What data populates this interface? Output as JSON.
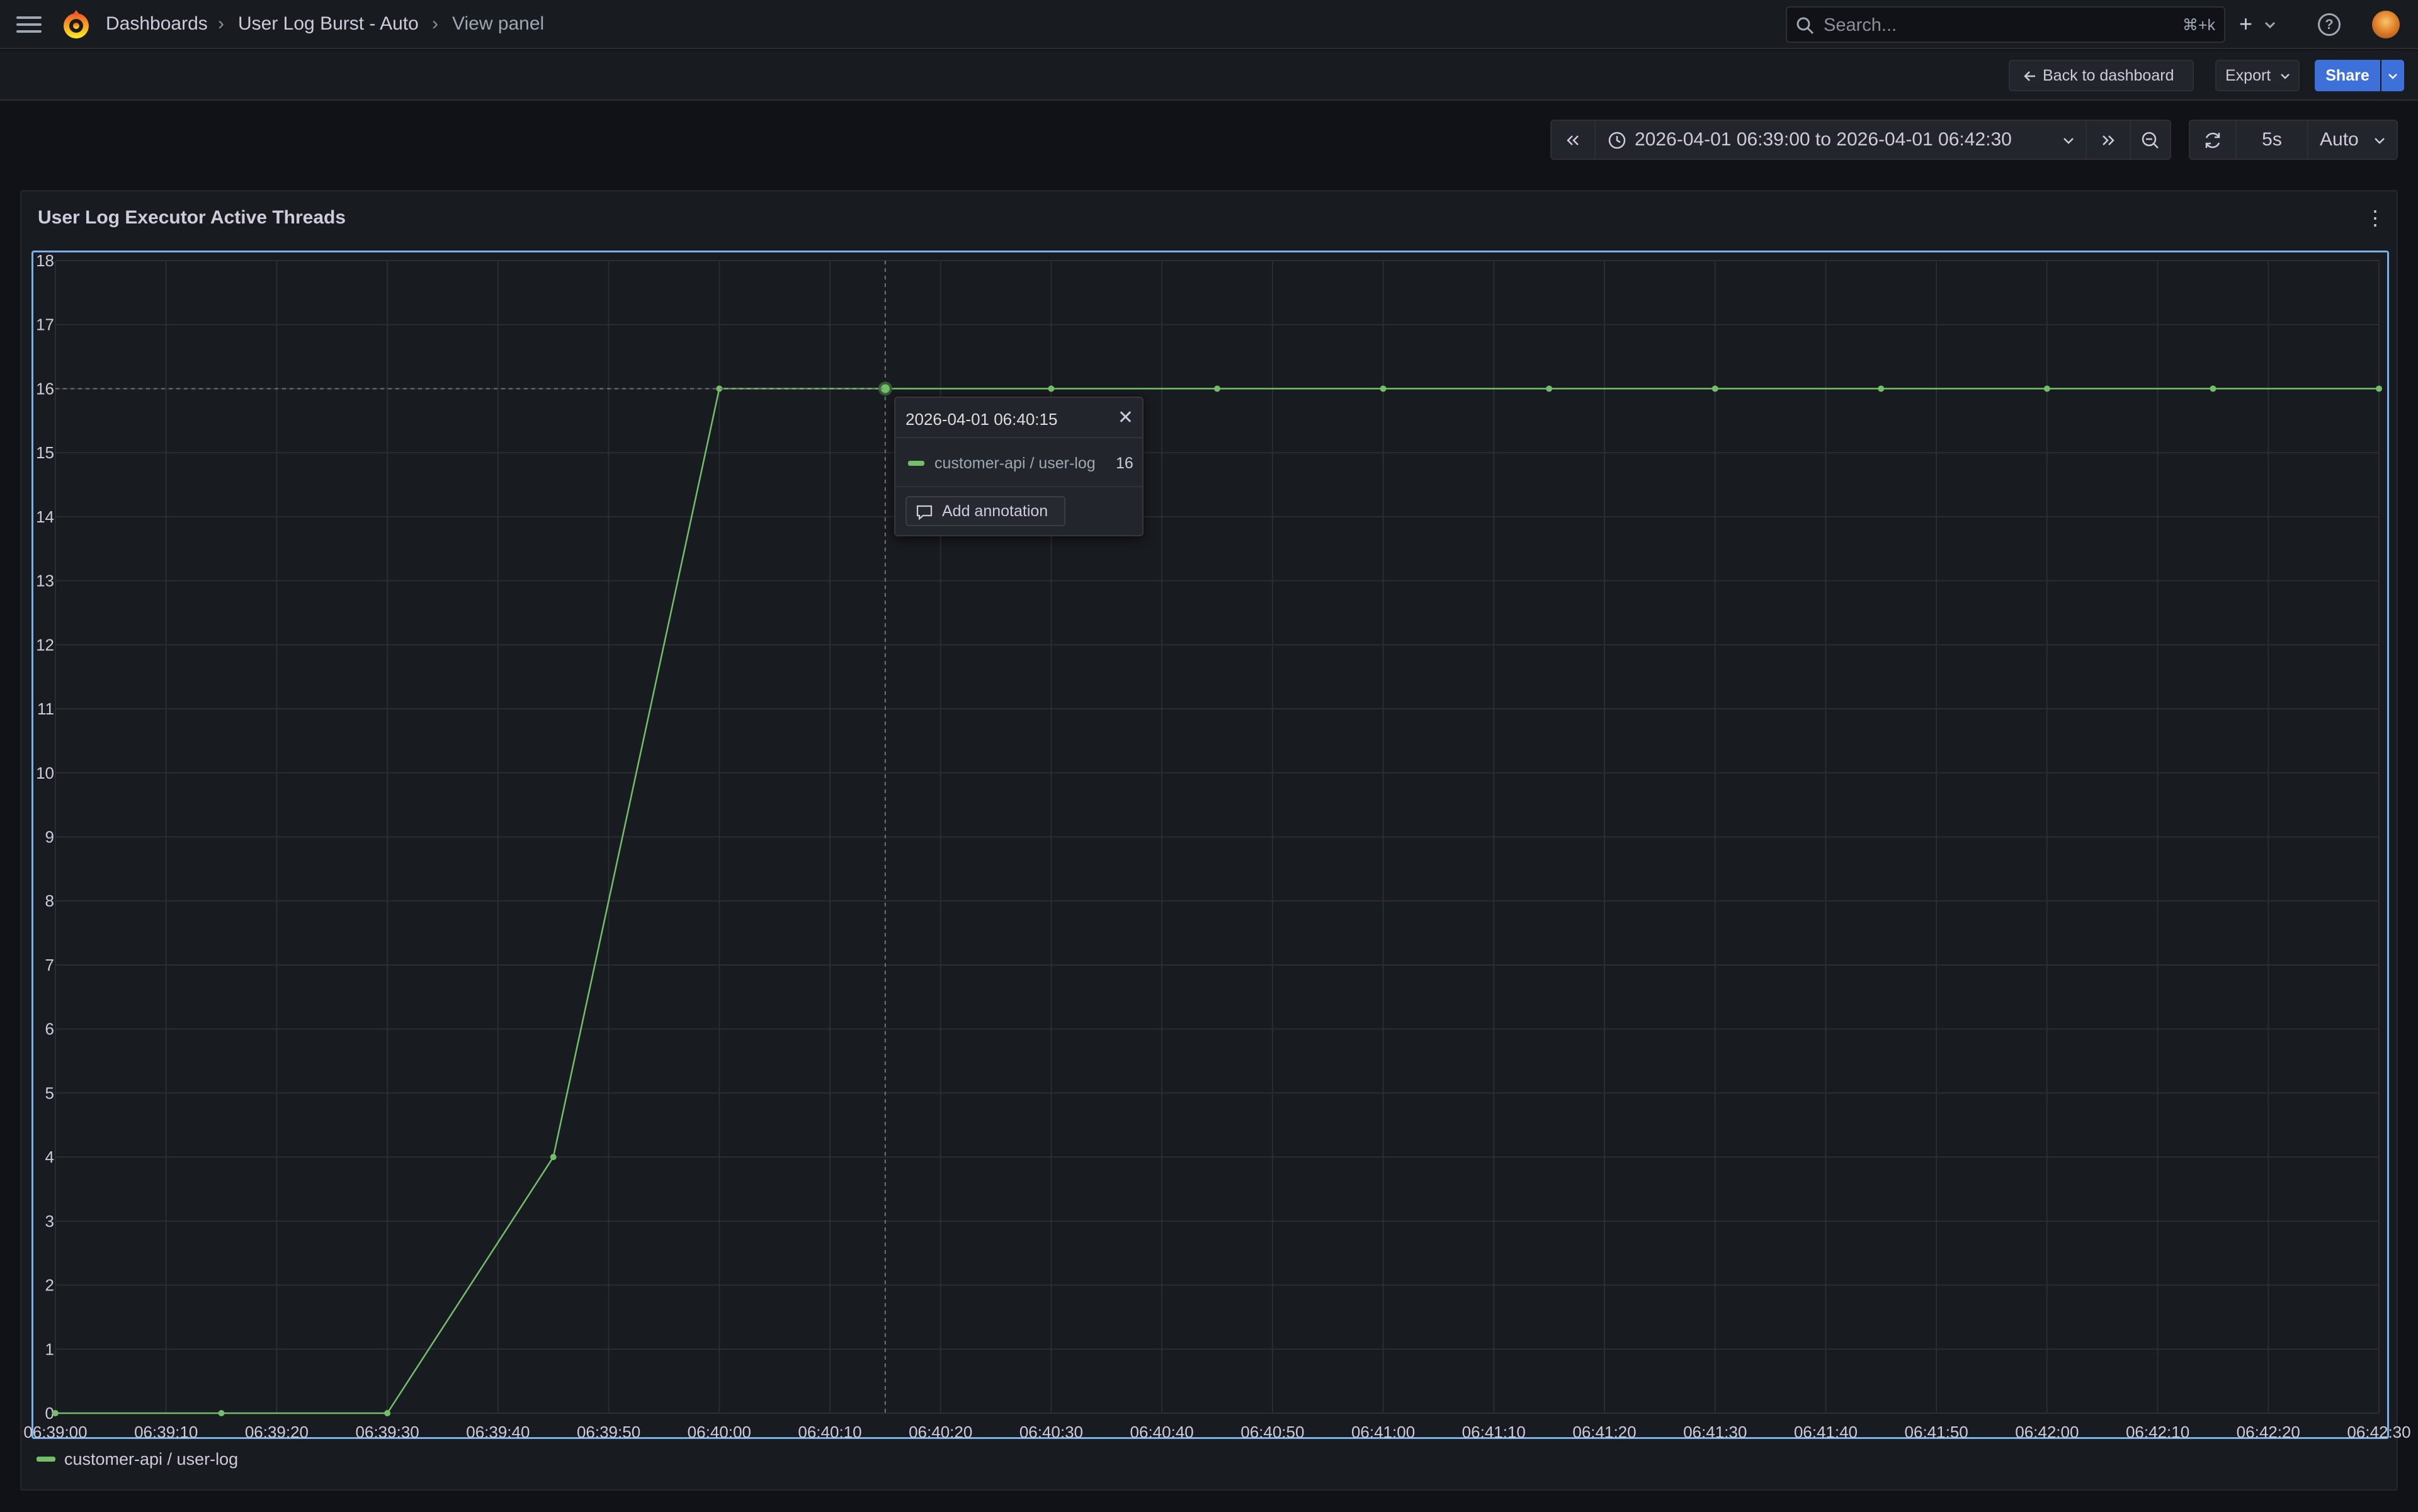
{
  "breadcrumb": {
    "items": [
      "Dashboards",
      "User Log Burst - Auto",
      "View panel"
    ],
    "separator": "›"
  },
  "search": {
    "placeholder": "Search...",
    "shortcut": "⌘+k"
  },
  "topbar": {
    "plus_label": "+"
  },
  "toolbar": {
    "back_label": "Back to dashboard",
    "export_label": "Export",
    "share_label": "Share"
  },
  "time_controls": {
    "range_label": "2026-04-01 06:39:00 to 2026-04-01 06:42:30",
    "refresh_interval": "5s",
    "auto_label": "Auto"
  },
  "panel": {
    "title": "User Log Executor Active Threads"
  },
  "tooltip": {
    "time": "2026-04-01 06:40:15",
    "series": "customer-api / user-log",
    "value": "16",
    "add_annotation": "Add annotation"
  },
  "colors": {
    "series": "#73bf69",
    "accent": "#3d71d9",
    "background": "#111217",
    "panel": "#181b1f"
  },
  "icons": [
    "menu-icon",
    "grafana-logo",
    "search-icon",
    "plus-icon",
    "help-icon",
    "arrow-left-icon",
    "chevron-down-icon",
    "clock-icon",
    "zoom-out-icon",
    "refresh-icon",
    "kebab-menu-icon",
    "comment-icon",
    "close-icon"
  ],
  "chart_data": {
    "type": "line",
    "title": "User Log Executor Active Threads",
    "x_tick_labels": [
      "06:39:00",
      "06:39:10",
      "06:39:20",
      "06:39:30",
      "06:39:40",
      "06:39:50",
      "06:40:00",
      "06:40:10",
      "06:40:20",
      "06:40:30",
      "06:40:40",
      "06:40:50",
      "06:41:00",
      "06:41:10",
      "06:41:20",
      "06:41:30",
      "06:41:40",
      "06:41:50",
      "06:42:00",
      "06:42:10",
      "06:42:20",
      "06:42:30"
    ],
    "y_tick_labels": [
      "0",
      "1",
      "2",
      "3",
      "4",
      "5",
      "6",
      "7",
      "8",
      "9",
      "10",
      "11",
      "12",
      "13",
      "14",
      "15",
      "16",
      "17",
      "18"
    ],
    "xlim": [
      "06:39:00",
      "06:42:30"
    ],
    "ylim": [
      0,
      18
    ],
    "grid": true,
    "legend": "bottom-left",
    "hover_time": "06:40:15",
    "series": [
      {
        "name": "customer-api / user-log",
        "color": "#73bf69",
        "x": [
          "06:39:00",
          "06:39:15",
          "06:39:30",
          "06:39:45",
          "06:40:00",
          "06:40:15",
          "06:40:30",
          "06:40:45",
          "06:41:00",
          "06:41:15",
          "06:41:30",
          "06:41:45",
          "06:42:00",
          "06:42:15",
          "06:42:30"
        ],
        "values": [
          0,
          0,
          0,
          4,
          16,
          16,
          16,
          16,
          16,
          16,
          16,
          16,
          16,
          16,
          16
        ]
      }
    ]
  }
}
